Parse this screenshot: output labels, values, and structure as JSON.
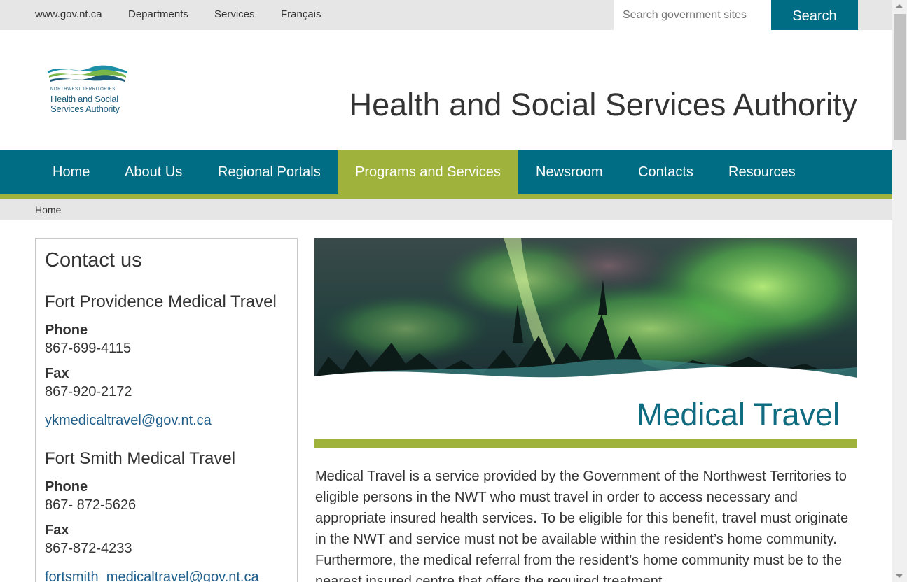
{
  "utility": {
    "links": [
      "www.gov.nt.ca",
      "Departments",
      "Services",
      "Français"
    ],
    "search_placeholder": "Search government sites",
    "search_button": "Search"
  },
  "header": {
    "logo_line1": "NORTHWEST TERRITORIES",
    "logo_line2": "Health and Social",
    "logo_line3": "Services Authority",
    "title": "Health and Social Services Authority"
  },
  "nav": {
    "items": [
      "Home",
      "About Us",
      "Regional Portals",
      "Programs and Services",
      "Newsroom",
      "Contacts",
      "Resources"
    ],
    "active": "Programs and Services"
  },
  "breadcrumb": {
    "items": [
      "Home"
    ]
  },
  "sidebar": {
    "title": "Contact us",
    "contacts": [
      {
        "name": "Fort Providence Medical Travel",
        "phone_label": "Phone",
        "phone": "867-699-4115",
        "fax_label": "Fax",
        "fax": "867-920-2172",
        "email": "ykmedicaltravel@gov.nt.ca"
      },
      {
        "name": "Fort Smith Medical Travel",
        "phone_label": "Phone",
        "phone": "867- 872-5626",
        "fax_label": "Fax",
        "fax": "867-872-4233",
        "email": "fortsmith_medicaltravel@gov.nt.ca"
      }
    ]
  },
  "main": {
    "title": "Medical Travel",
    "paragraph": "Medical Travel is a service provided by the Government of the Northwest Territories to eligible persons in the NWT who must travel in order to access necessary and appropriate insured health services. To be eligible for this benefit, travel must originate in the NWT and service must not be available within the resident’s home community. Furthermore, the medical referral from the resident’s home community must be to the nearest insured centre that offers the required treatment."
  },
  "colors": {
    "teal": "#006d84",
    "green_accent": "#9fb23c",
    "link": "#1d5d8a",
    "title_teal": "#0f6b80"
  }
}
